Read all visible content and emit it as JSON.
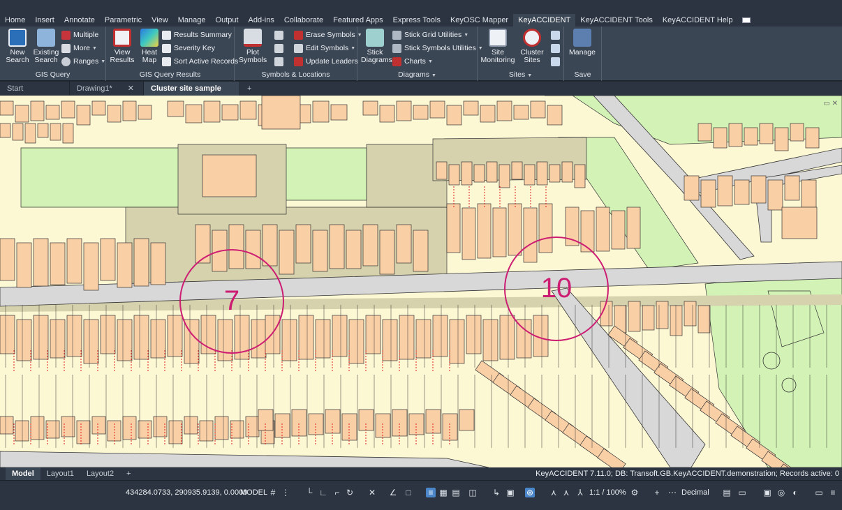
{
  "ribbon": {
    "tabs": [
      "Home",
      "Insert",
      "Annotate",
      "Parametric",
      "View",
      "Manage",
      "Output",
      "Add-ins",
      "Collaborate",
      "Featured Apps",
      "Express Tools",
      "KeyOSC Mapper",
      "KeyACCIDENT",
      "KeyACCIDENT Tools",
      "KeyACCIDENT Help"
    ],
    "active_tab": "KeyACCIDENT"
  },
  "panels": {
    "gis_query": {
      "label": "GIS Query",
      "new_search": "New Search",
      "existing_search": "Existing Search",
      "multiple": "Multiple",
      "more": "More",
      "ranges": "Ranges"
    },
    "gis_query_results": {
      "label": "GIS Query Results",
      "view_results": "View Results",
      "heat_map": "Heat Map",
      "results_summary": "Results Summary",
      "severity_key": "Severity Key",
      "sort_active_records": "Sort Active Records"
    },
    "symbols_locations": {
      "label": "Symbols & Locations",
      "plot_symbols": "Plot Symbols",
      "erase_symbols": "Erase Symbols",
      "edit_symbols": "Edit Symbols",
      "update_leaders": "Update Leaders"
    },
    "diagrams": {
      "label": "Diagrams",
      "stick_diagrams": "Stick Diagrams",
      "stick_grid_utilities": "Stick Grid Utilities",
      "stick_symbols_utilities": "Stick Symbols Utilities",
      "charts": "Charts"
    },
    "sites": {
      "label": "Sites",
      "site_monitoring": "Site Monitoring",
      "cluster_sites": "Cluster Sites"
    },
    "save": {
      "label": "Save",
      "manage": "Manage"
    }
  },
  "doc_tabs": [
    "Start",
    "Drawing1*",
    "Cluster site sample plot"
  ],
  "active_doc": "Cluster site sample plot",
  "map": {
    "clusters": [
      {
        "label": "7",
        "color": "#cc1d73"
      },
      {
        "label": "10",
        "color": "#cc1d73"
      }
    ],
    "colors": {
      "building": "#f9cfa6",
      "plot": "#fdf8d4",
      "road": "#d8d8d8",
      "green": "#d3f2b5",
      "open": "#d6d2ad",
      "boundary_red": "#e01b1b"
    }
  },
  "layout_tabs": [
    "Model",
    "Layout1",
    "Layout2"
  ],
  "status": {
    "message": "KeyACCIDENT 7.11.0; DB: Transoft.GB.KeyACCIDENT.demonstration; Records active: 0",
    "coords": "434284.0733, 290935.9139, 0.0000",
    "model": "MODEL",
    "scale": "1:1 / 100%",
    "units": "Decimal"
  }
}
